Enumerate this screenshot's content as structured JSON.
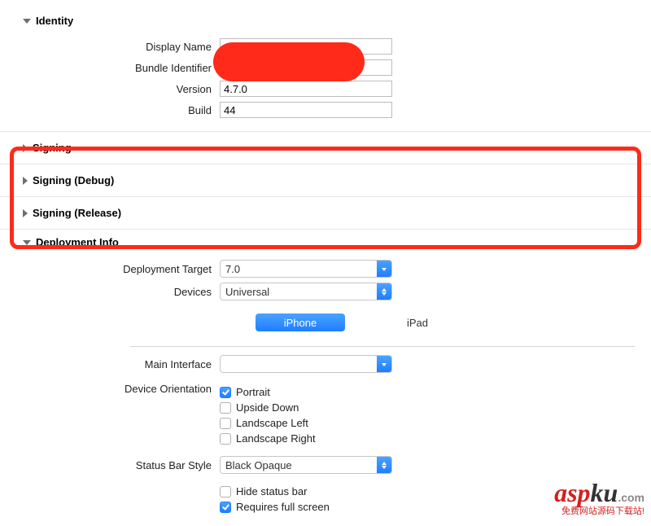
{
  "identity": {
    "title": "Identity",
    "display_name_label": "Display Name",
    "display_name_value": "",
    "bundle_id_label": "Bundle Identifier",
    "bundle_id_value": "",
    "version_label": "Version",
    "version_value": "4.7.0",
    "build_label": "Build",
    "build_value": "44"
  },
  "signing": {
    "title": "Signing",
    "debug_title": "Signing (Debug)",
    "release_title": "Signing (Release)"
  },
  "deployment": {
    "title": "Deployment Info",
    "target_label": "Deployment Target",
    "target_value": "7.0",
    "devices_label": "Devices",
    "devices_value": "Universal",
    "tabs": {
      "iphone": "iPhone",
      "ipad": "iPad"
    },
    "main_interface_label": "Main Interface",
    "main_interface_value": "",
    "orientation_label": "Device Orientation",
    "orientations": {
      "portrait": "Portrait",
      "upside_down": "Upside Down",
      "landscape_left": "Landscape Left",
      "landscape_right": "Landscape Right"
    },
    "status_bar_label": "Status Bar Style",
    "status_bar_value": "Black Opaque",
    "hide_status_bar_label": "Hide status bar",
    "requires_full_screen_label": "Requires full screen"
  },
  "watermark": {
    "brand_a": "asp",
    "brand_b": "ku",
    "dot_com": ".com",
    "tagline": "免费网站源码下载站!"
  }
}
